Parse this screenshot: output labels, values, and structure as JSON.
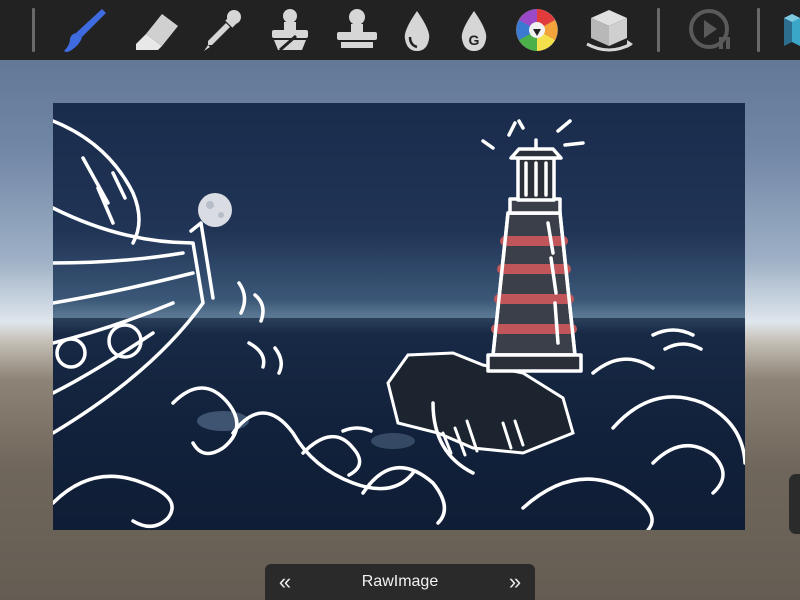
{
  "toolbar": {
    "tools": [
      {
        "name": "brush-tool",
        "icon": "paintbrush-icon",
        "selected": true
      },
      {
        "name": "eraser-tool",
        "icon": "eraser-icon",
        "selected": false
      },
      {
        "name": "eyedropper-tool",
        "icon": "eyedropper-icon",
        "selected": false
      },
      {
        "name": "clone-stamp-tool",
        "icon": "stamp-brush-icon",
        "selected": false
      },
      {
        "name": "stamp-tool",
        "icon": "stamp-icon",
        "selected": false
      },
      {
        "name": "fill-tool",
        "icon": "drop-icon",
        "selected": false
      },
      {
        "name": "gradient-fill-tool",
        "icon": "drop-g-icon",
        "letter": "G",
        "selected": false
      },
      {
        "name": "color-picker-tool",
        "icon": "color-wheel-icon",
        "selected": false
      },
      {
        "name": "save-3d-tool",
        "icon": "cube-rotate-icon",
        "selected": false
      },
      {
        "name": "play-pause-tool",
        "icon": "play-pause-icon",
        "selected": false
      }
    ],
    "accent": "#3f6be0"
  },
  "canvas": {
    "description_icon": "lighthouse-sketch-image"
  },
  "bottom_bar": {
    "prev_label": "«",
    "title": "RawImage",
    "next_label": "»"
  }
}
